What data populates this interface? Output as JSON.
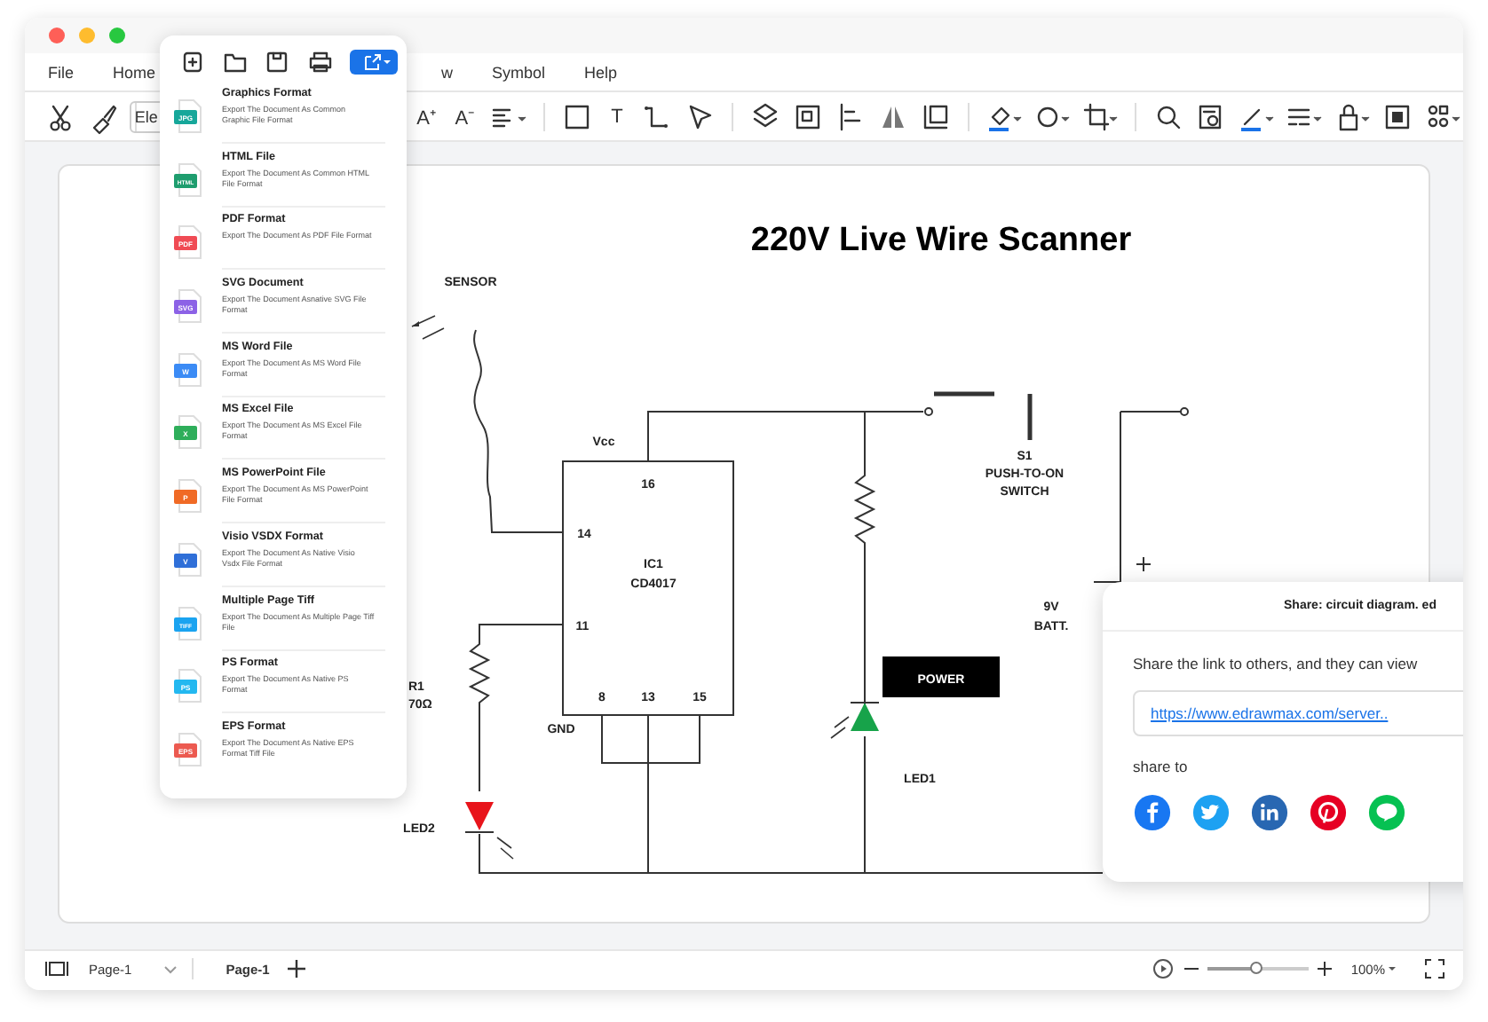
{
  "menu": [
    {
      "label": "File"
    },
    {
      "label": "Home"
    },
    {
      "label": "w",
      "kind": "cut"
    },
    {
      "label": "Symbol"
    },
    {
      "label": "Help"
    }
  ],
  "toolbar": {
    "font_field": "Ele",
    "items": [
      {
        "kind": "grow",
        "glyph": "A⁺"
      },
      {
        "kind": "shrink",
        "glyph": "A⁻"
      },
      {
        "kind": "align"
      },
      {
        "kind": "sep"
      },
      {
        "kind": "rect"
      },
      {
        "kind": "text",
        "glyph": "T"
      },
      {
        "kind": "connector"
      },
      {
        "kind": "pointer"
      },
      {
        "kind": "sep"
      },
      {
        "kind": "layers"
      },
      {
        "kind": "group"
      },
      {
        "kind": "align-left"
      },
      {
        "kind": "flip"
      },
      {
        "kind": "frame"
      },
      {
        "kind": "sep"
      },
      {
        "kind": "fill"
      },
      {
        "kind": "shape"
      },
      {
        "kind": "crop"
      },
      {
        "kind": "sep"
      },
      {
        "kind": "search"
      },
      {
        "kind": "find"
      },
      {
        "kind": "pen"
      },
      {
        "kind": "line-style"
      },
      {
        "kind": "lock"
      },
      {
        "kind": "focus"
      },
      {
        "kind": "more"
      }
    ]
  },
  "export_menu": {
    "items": [
      {
        "title": "Graphics Format",
        "description": "Export The Document As Common Graphic File Format",
        "badge": "JPG",
        "color": "#16a79a"
      },
      {
        "title": "HTML File",
        "description": "Export The Document As Common HTML File Format",
        "badge": "HTML",
        "color": "#1e9d6e"
      },
      {
        "title": "PDF Format",
        "description": "Export The Document As PDF File Format",
        "badge": "PDF",
        "color": "#f04b54"
      },
      {
        "title": "SVG Document",
        "description": "Export The Document Asnative SVG File Format",
        "badge": "SVG",
        "color": "#8c62e6"
      },
      {
        "title": "MS Word File",
        "description": "Export The Document As MS Word File Format",
        "badge": "W",
        "color": "#3b8bf5"
      },
      {
        "title": "MS Excel File",
        "description": "Export The Document As MS Excel File Format",
        "badge": "X",
        "color": "#2eae5a"
      },
      {
        "title": "MS PowerPoint File",
        "description": "Export The Document As MS PowerPoint File Format",
        "badge": "P",
        "color": "#f06a25"
      },
      {
        "title": "Visio VSDX Format",
        "description": "Export The Document As Native Visio Vsdx File Format",
        "badge": "V",
        "color": "#2f6fd8"
      },
      {
        "title": "Multiple Page Tiff",
        "description": "Export The Document As Multiple Page Tiff File",
        "badge": "TIFF",
        "color": "#1aa3f0"
      },
      {
        "title": "PS Format",
        "description": "Export The Document As Native PS Format",
        "badge": "PS",
        "color": "#23b8f0"
      },
      {
        "title": "EPS Format",
        "description": "Export The Document As Native EPS Format Tiff File",
        "badge": "EPS",
        "color": "#ec5a50"
      }
    ]
  },
  "diagram": {
    "title": "220V Live Wire Scanner",
    "labels": {
      "sensor": "SENSOR",
      "vcc": "Vcc",
      "pin16": "16",
      "pin14": "14",
      "ic_name": "IC1",
      "ic_part": "CD4017",
      "pin11": "11",
      "pin8": "8",
      "pin13": "13",
      "pin15": "15",
      "r1": "R1",
      "r1_value": "70Ω",
      "gnd": "GND",
      "led2": "LED2",
      "s1": "S1",
      "switch_type": "PUSH-TO-ON",
      "switch_word": "SWITCH",
      "battery_voltage": "9V",
      "battery_word": "BATT.",
      "power": "POWER",
      "led1": "LED1"
    }
  },
  "share_panel": {
    "title": "Share: circuit diagram. ed",
    "message": "Share the link to others, and they can view",
    "link": "https://www.edrawmax.com/server..",
    "share_label": "share to",
    "targets": [
      {
        "kind": "facebook",
        "color": "#1877f2"
      },
      {
        "kind": "twitter",
        "color": "#1da1f2"
      },
      {
        "kind": "linkedin",
        "color": "#2867b2"
      },
      {
        "kind": "pinterest",
        "color": "#e60023"
      },
      {
        "kind": "line",
        "color": "#06c152"
      }
    ]
  },
  "status_bar": {
    "page_select": "Page-1",
    "page_tab": "Page-1",
    "zoom": "100%",
    "level": 0.5
  }
}
